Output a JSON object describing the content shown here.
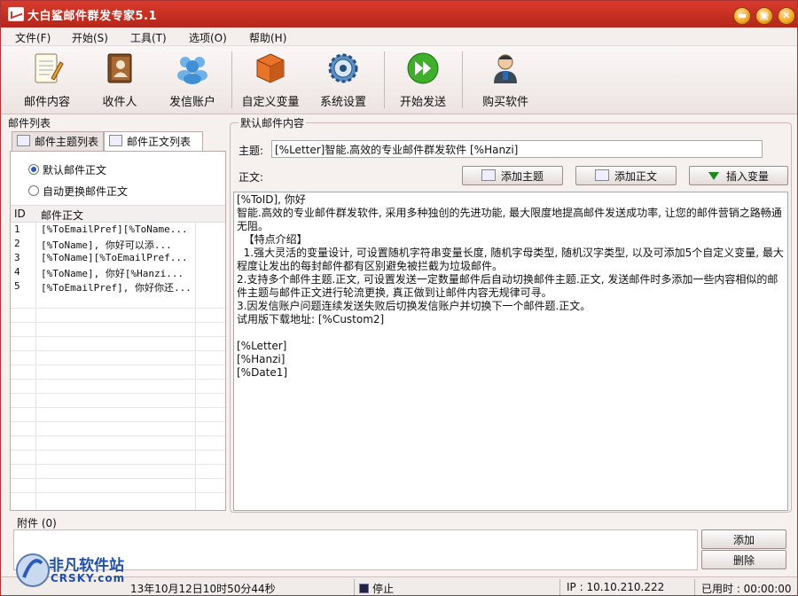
{
  "window": {
    "title": "大白鲨邮件群发专家5.1",
    "minimize": "▬",
    "maximize": "▣",
    "close": "✕"
  },
  "menu": [
    "文件(F)",
    "开始(S)",
    "工具(T)",
    "选项(O)",
    "帮助(H)"
  ],
  "toolbar": [
    {
      "label": "邮件内容",
      "icon": "notepad-icon"
    },
    {
      "label": "收件人",
      "icon": "address-book-icon"
    },
    {
      "label": "发信账户",
      "icon": "users-icon"
    },
    {
      "label": "自定义变量",
      "icon": "box-icon"
    },
    {
      "label": "系统设置",
      "icon": "gear-icon"
    },
    {
      "label": "开始发送",
      "icon": "play-icon"
    },
    {
      "label": "购买软件",
      "icon": "person-icon"
    }
  ],
  "left": {
    "group_title": "邮件列表",
    "tabs": [
      "邮件主题列表",
      "邮件正文列表"
    ],
    "radios": [
      "默认邮件正文",
      "自动更换邮件正文"
    ],
    "columns": [
      "ID",
      "邮件正文"
    ],
    "rows": [
      {
        "id": "1",
        "text": "[%ToEmailPref][%ToName..."
      },
      {
        "id": "2",
        "text": "[%ToName], 你好可以添..."
      },
      {
        "id": "3",
        "text": "[%ToName][%ToEmailPref..."
      },
      {
        "id": "4",
        "text": "[%ToName], 你好[%Hanzi..."
      },
      {
        "id": "5",
        "text": "[%ToEmailPref], 你好你还..."
      }
    ]
  },
  "right": {
    "group_title": "默认邮件内容",
    "subject_label": "主题:",
    "subject_value": "[%Letter]智能.高效的专业邮件群发软件 [%Hanzi]",
    "body_label": "正文:",
    "buttons": {
      "add_subject": "添加主题",
      "add_body": "添加正文",
      "insert_var": "插入变量"
    },
    "body_text": "[%ToID], 你好\n智能.高效的专业邮件群发软件, 采用多种独创的先进功能, 最大限度地提高邮件发送成功率, 让您的邮件营销之路畅通无阻。\n  【特点介绍】\n  1.强大灵活的变量设计, 可设置随机字符串变量长度, 随机字母类型, 随机汉字类型, 以及可添加5个自定义变量, 最大程度让发出的每封邮件都有区别避免被拦截为垃圾邮件。\n2.支持多个邮件主题.正文, 可设置发送一定数量邮件后自动切换邮件主题.正文, 发送邮件时多添加一些内容相似的邮件主题与邮件正文进行轮流更换, 真正做到让邮件内容无规律可寻。\n3.因发信账户问题连续发送失败后切换发信账户并切换下一个邮件题.正文。\n试用版下载地址: [%Custom2]\n\n[%Letter]\n[%Hanzi]\n[%Date1]"
  },
  "attachment": {
    "label": "附件 (0)",
    "add": "添加",
    "delete": "删除"
  },
  "status": {
    "time": "13年10月12日10时50分44秒",
    "state": "停止",
    "ip": "IP : 10.10.210.222",
    "elapsed": "已用时 : 00:00:00"
  },
  "watermark": {
    "name": "非凡软件站",
    "sub": "CRSKY.com"
  },
  "colors": {
    "titlebar": "#c8301f",
    "accent": "#2a5bb8"
  }
}
